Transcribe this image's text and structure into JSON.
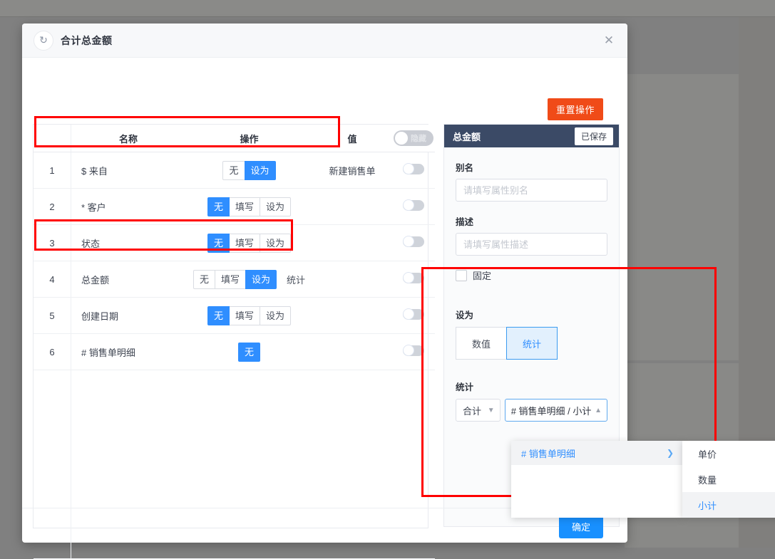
{
  "modal": {
    "title": "合计总金额",
    "refresh_icon": "refresh-icon",
    "close_icon": "close-icon",
    "reset_button": "重置操作",
    "confirm_button": "确定"
  },
  "table": {
    "headers": {
      "index": "",
      "name": "名称",
      "operation": "操作",
      "value": "值",
      "toggle_label": "隐藏"
    },
    "rows": [
      {
        "index": "1",
        "name": "$ 来自",
        "ops": [
          {
            "label": "无",
            "active": false
          },
          {
            "label": "设为",
            "active": true
          }
        ],
        "tail": "",
        "value": "新建销售单"
      },
      {
        "index": "2",
        "name": "* 客户",
        "ops": [
          {
            "label": "无",
            "active": true
          },
          {
            "label": "填写",
            "active": false
          },
          {
            "label": "设为",
            "active": false
          }
        ],
        "tail": "",
        "value": ""
      },
      {
        "index": "3",
        "name": "状态",
        "ops": [
          {
            "label": "无",
            "active": true
          },
          {
            "label": "填写",
            "active": false
          },
          {
            "label": "设为",
            "active": false
          }
        ],
        "tail": "",
        "value": ""
      },
      {
        "index": "4",
        "name": "总金额",
        "ops": [
          {
            "label": "无",
            "active": false
          },
          {
            "label": "填写",
            "active": false
          },
          {
            "label": "设为",
            "active": true
          }
        ],
        "tail": "统计",
        "value": ""
      },
      {
        "index": "5",
        "name": "创建日期",
        "ops": [
          {
            "label": "无",
            "active": true
          },
          {
            "label": "填写",
            "active": false
          },
          {
            "label": "设为",
            "active": false
          }
        ],
        "tail": "",
        "value": ""
      },
      {
        "index": "6",
        "name": "# 销售单明细",
        "ops": [
          {
            "label": "无",
            "active": true
          }
        ],
        "tail": "",
        "value": ""
      }
    ]
  },
  "side": {
    "title": "总金额",
    "saved_badge": "已保存",
    "alias_label": "别名",
    "alias_value": "",
    "alias_placeholder": "请填写属性别名",
    "desc_label": "描述",
    "desc_value": "",
    "desc_placeholder": "请填写属性描述",
    "fixed_label": "固定",
    "fixed_checked": false,
    "setas_label": "设为",
    "setas_options": [
      {
        "label": "数值",
        "active": false
      },
      {
        "label": "统计",
        "active": true
      }
    ],
    "stat_label": "统计",
    "agg_value": "合计",
    "field_value": "# 销售单明细 / 小计",
    "dropdown": {
      "items": [
        {
          "label": "# 销售单明细",
          "has_submenu": true
        }
      ],
      "submenu": [
        {
          "label": "单价",
          "selected": false
        },
        {
          "label": "数量",
          "selected": false
        },
        {
          "label": "小计",
          "selected": true
        }
      ]
    }
  },
  "colors": {
    "accent_blue": "#2f8eff",
    "reset_orange": "#f04b18",
    "confirm_blue": "#1890ff",
    "panel_header": "#3b4a66",
    "highlight_red": "#ff0000"
  }
}
